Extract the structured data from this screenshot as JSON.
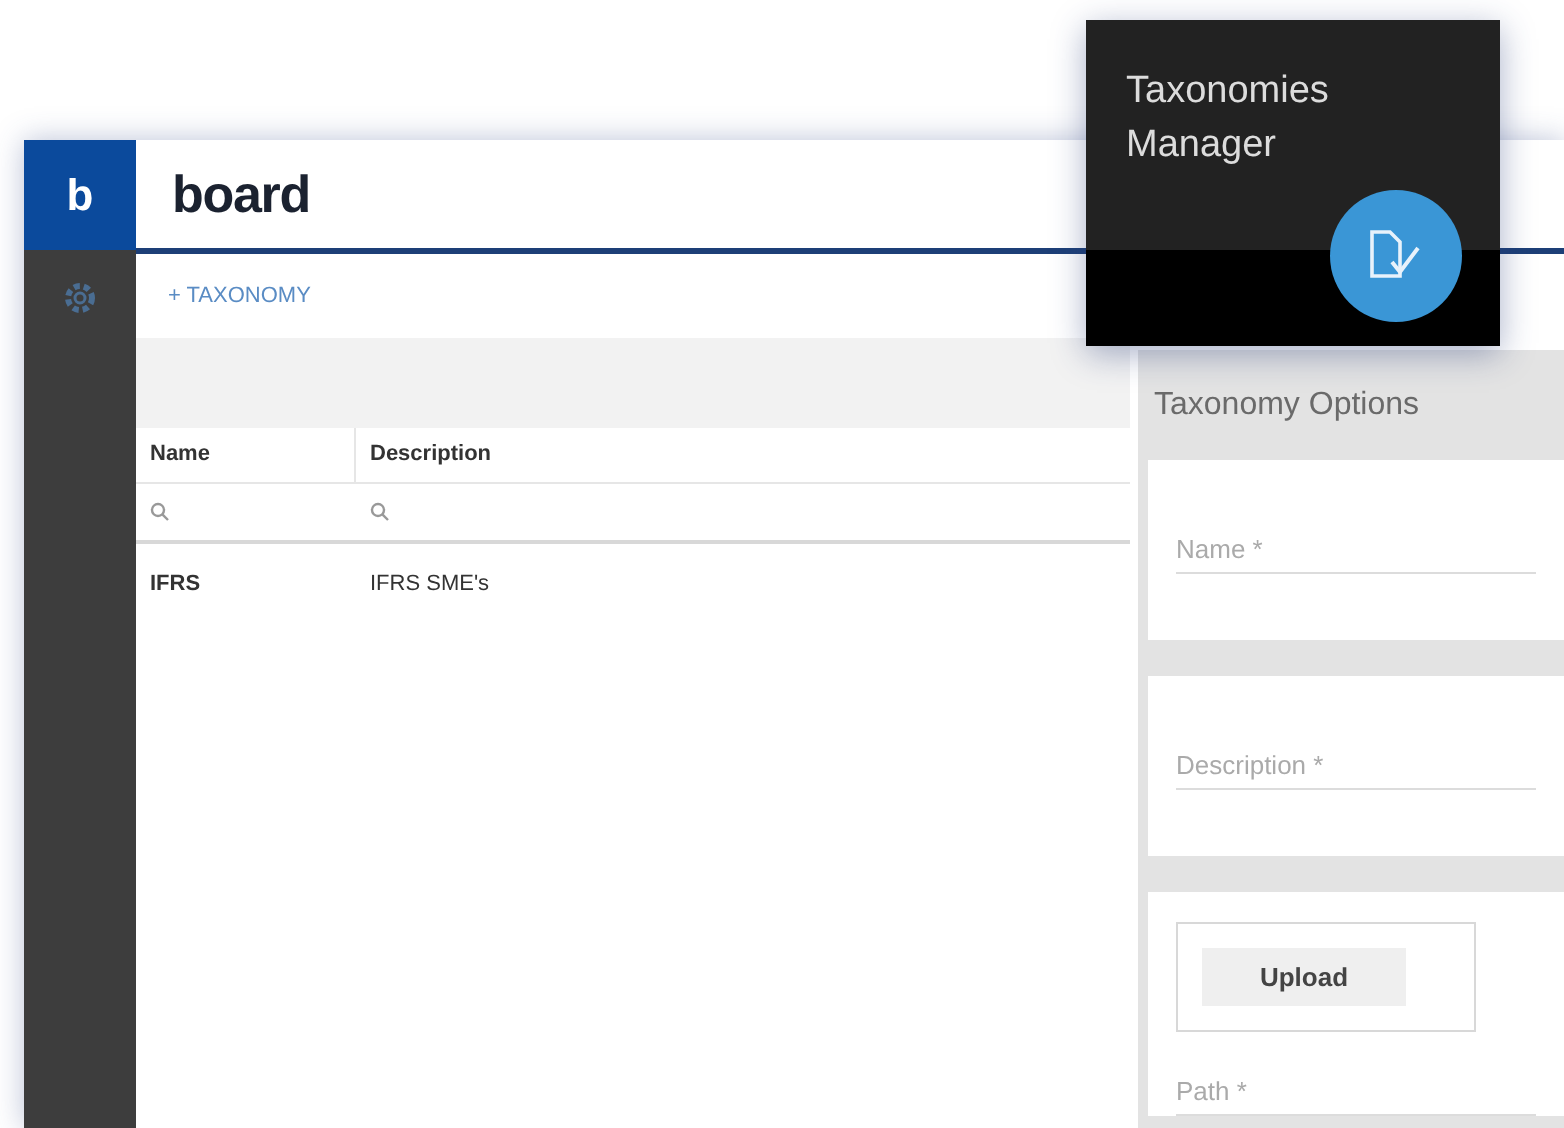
{
  "logo": {
    "mark": "b",
    "wordmark": "board"
  },
  "toolbar": {
    "add_button": "+ TAXONOMY"
  },
  "table": {
    "columns": [
      "Name",
      "Description"
    ],
    "rows": [
      [
        "IFRS",
        "IFRS SME's"
      ]
    ]
  },
  "options_panel": {
    "title": "Taxonomy Options",
    "fields": [
      {
        "kind": "text",
        "placeholder": "Name *"
      },
      {
        "kind": "text",
        "placeholder": "Description *"
      },
      {
        "kind": "upload",
        "button": "Upload",
        "placeholder": "Path *"
      }
    ]
  },
  "popup": {
    "title": "Taxonomies Manager"
  }
}
